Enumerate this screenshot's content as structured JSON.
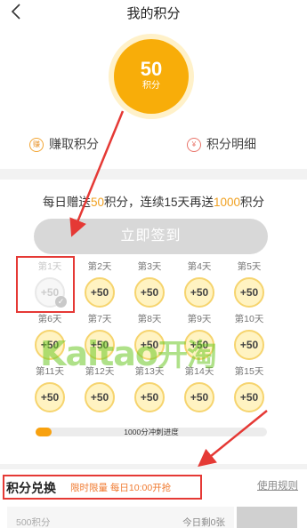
{
  "header": {
    "title": "我的积分"
  },
  "points": {
    "value": "50",
    "unit": "积分"
  },
  "links": [
    {
      "icon": "赚",
      "label": "赚取积分"
    },
    {
      "icon": "¥",
      "label": "积分明细"
    }
  ],
  "sign": {
    "desc_prefix": "每日赠送",
    "desc_daily": "50",
    "desc_mid": "积分，连续15天再送",
    "desc_bonus": "1000",
    "desc_suffix": "积分",
    "button": "立即签到",
    "days": [
      {
        "label": "第1天",
        "reward": "+50",
        "done": true
      },
      {
        "label": "第2天",
        "reward": "+50"
      },
      {
        "label": "第3天",
        "reward": "+50"
      },
      {
        "label": "第4天",
        "reward": "+50"
      },
      {
        "label": "第5天",
        "reward": "+50"
      },
      {
        "label": "第6天",
        "reward": "+50"
      },
      {
        "label": "第7天",
        "reward": "+50"
      },
      {
        "label": "第8天",
        "reward": "+50"
      },
      {
        "label": "第9天",
        "reward": "+50"
      },
      {
        "label": "第10天",
        "reward": "+50"
      },
      {
        "label": "第11天",
        "reward": "+50"
      },
      {
        "label": "第12天",
        "reward": "+50"
      },
      {
        "label": "第13天",
        "reward": "+50"
      },
      {
        "label": "第14天",
        "reward": "+50"
      },
      {
        "label": "第15天",
        "reward": "+50"
      }
    ],
    "progress_label": "1000分冲刺进度",
    "progress_fraction": 0.07
  },
  "watermark": {
    "latin": "Kaitao",
    "cn": "开淘"
  },
  "exchange": {
    "title": "积分兑换",
    "tag": "限时限量 每日10:00开抢",
    "rules": "使用规则",
    "item_points": "500积分",
    "item_left": "今日剩0张"
  },
  "colors": {
    "accent": "#f8ad09",
    "annotation": "#e53935"
  }
}
